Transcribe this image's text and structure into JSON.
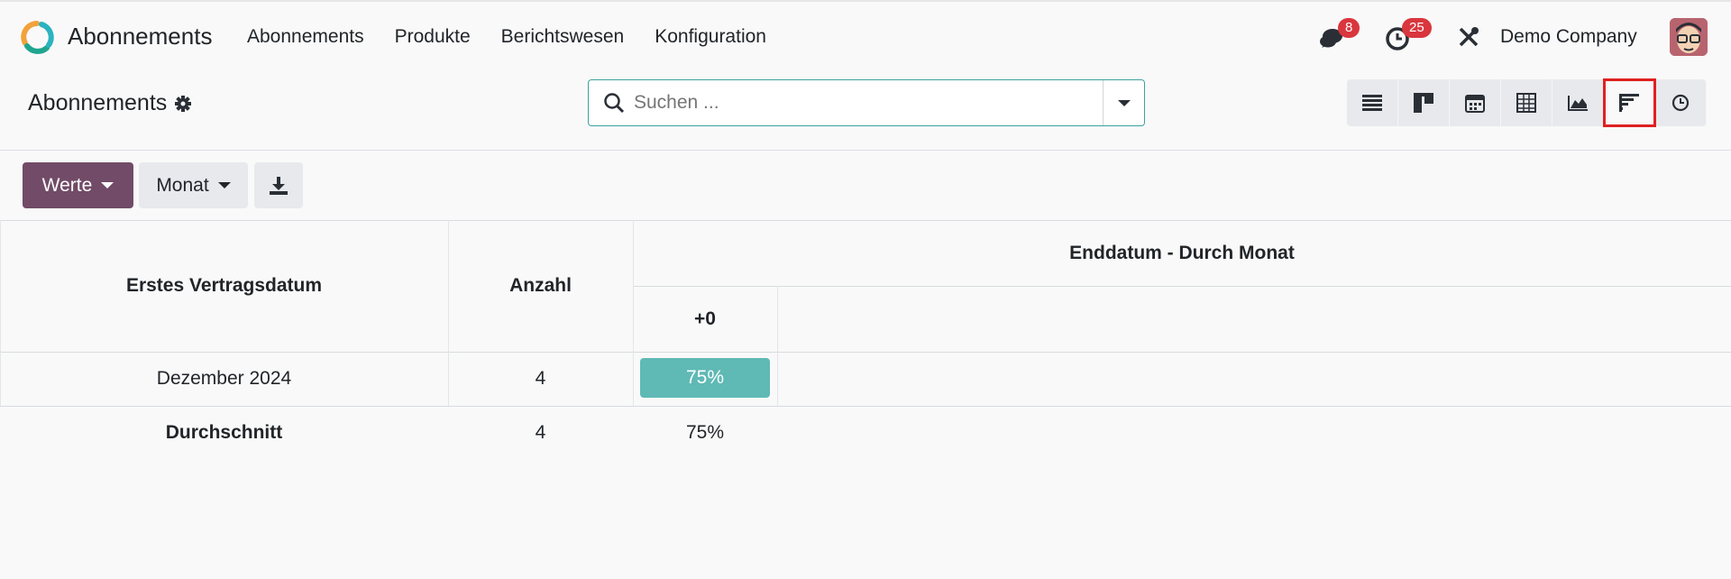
{
  "app": {
    "name": "Abonnements",
    "logo_icon": "app-logo-icon"
  },
  "menu": [
    "Abonnements",
    "Produkte",
    "Berichtswesen",
    "Konfiguration"
  ],
  "systray": {
    "messages_count": "8",
    "activities_count": "25",
    "company": "Demo Company"
  },
  "control_panel": {
    "title": "Abonnements",
    "search_placeholder": "Suchen ..."
  },
  "views": [
    "list-view-icon",
    "kanban-view-icon",
    "calendar-view-icon",
    "pivot-view-icon",
    "graph-view-icon",
    "cohort-view-icon",
    "activity-view-icon"
  ],
  "active_view": "cohort-view-icon",
  "toolbar": {
    "measures_label": "Werte",
    "interval_label": "Monat"
  },
  "cohort": {
    "row_header": "Erstes Vertragsdatum",
    "count_header": "Anzahl",
    "date_header": "Enddatum - Durch Monat",
    "interval_header": "+0",
    "rows": [
      {
        "label": "Dezember 2024",
        "count": "4",
        "values": [
          "75%"
        ]
      }
    ],
    "footer": {
      "label": "Durchschnitt",
      "count": "4",
      "values": [
        "75%"
      ]
    }
  },
  "colors": {
    "brand": "#714b67",
    "cohort_cell": "#5fb9b5",
    "badge": "#d9363e",
    "highlight": "#e02020"
  }
}
